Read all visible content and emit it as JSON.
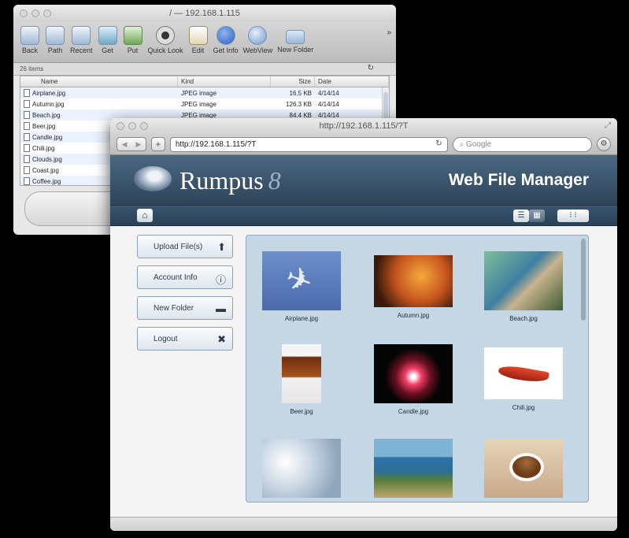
{
  "ftp_window": {
    "title": "/ — 192.168.1.115",
    "toolbar": [
      {
        "label": "Back",
        "icon": "back-arrow-icon"
      },
      {
        "label": "Path",
        "icon": "path-icon"
      },
      {
        "label": "Recent",
        "icon": "recent-icon"
      },
      {
        "label": "Get",
        "icon": "download-icon"
      },
      {
        "label": "Put",
        "icon": "upload-icon"
      },
      {
        "label": "Quick Look",
        "icon": "eye-icon"
      },
      {
        "label": "Edit",
        "icon": "edit-icon"
      },
      {
        "label": "Get Info",
        "icon": "info-icon"
      },
      {
        "label": "WebView",
        "icon": "globe-icon"
      },
      {
        "label": "New Folder",
        "icon": "folder-icon"
      }
    ],
    "overflow": "»",
    "status": "26 items",
    "columns": {
      "name": "Name",
      "kind": "Kind",
      "size": "Size",
      "date": "Date"
    },
    "files": [
      {
        "name": "Airplane.jpg",
        "kind": "JPEG image",
        "size": "16.5 KB",
        "date": "4/14/14"
      },
      {
        "name": "Autumn.jpg",
        "kind": "JPEG image",
        "size": "126.3 KB",
        "date": "4/14/14"
      },
      {
        "name": "Beach.jpg",
        "kind": "JPEG image",
        "size": "84.4 KB",
        "date": "4/14/14"
      },
      {
        "name": "Beer.jpg",
        "kind": "",
        "size": "",
        "date": ""
      },
      {
        "name": "Candle.jpg",
        "kind": "",
        "size": "",
        "date": ""
      },
      {
        "name": "Chili.jpg",
        "kind": "",
        "size": "",
        "date": ""
      },
      {
        "name": "Clouds.jpg",
        "kind": "",
        "size": "",
        "date": ""
      },
      {
        "name": "Coast.jpg",
        "kind": "",
        "size": "",
        "date": ""
      },
      {
        "name": "Coffee.jpg",
        "kind": "",
        "size": "",
        "date": ""
      }
    ]
  },
  "browser": {
    "title": "http://192.168.1.115/?T",
    "url": "http://192.168.1.115/?T",
    "search_placeholder": "Google",
    "logo_text": "Rumpus",
    "logo_version": "8",
    "header_title": "Web File Manager",
    "sidebar": [
      {
        "label": "Upload File(s)",
        "icon": "upload-arrow-icon"
      },
      {
        "label": "Account Info",
        "icon": "info-icon"
      },
      {
        "label": "New Folder",
        "icon": "folder-icon"
      },
      {
        "label": "Logout",
        "icon": "close-icon"
      }
    ],
    "gallery": [
      {
        "caption": "Airplane.jpg"
      },
      {
        "caption": "Autumn.jpg"
      },
      {
        "caption": "Beach.jpg"
      },
      {
        "caption": "Beer.jpg"
      },
      {
        "caption": "Candle.jpg"
      },
      {
        "caption": "Chili.jpg"
      },
      {
        "caption": ""
      },
      {
        "caption": ""
      },
      {
        "caption": ""
      }
    ]
  }
}
